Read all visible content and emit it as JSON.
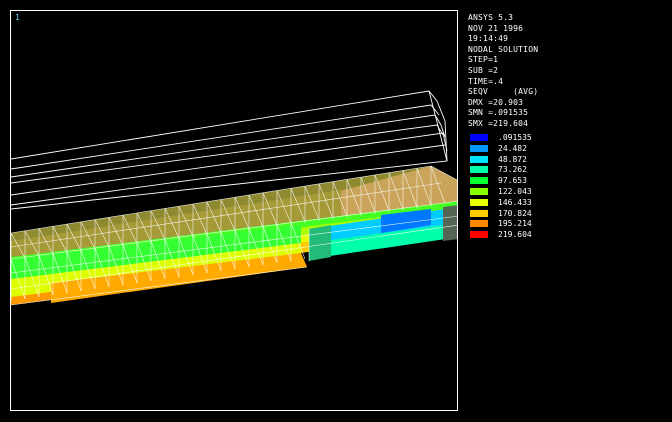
{
  "window": {
    "number": "1"
  },
  "header": {
    "lines": [
      "ANSYS 5.3",
      "NOV 21 1996",
      "19:14:49",
      "NODAL SOLUTION",
      "STEP=1",
      "SUB =2",
      "TIME=.4",
      "SEQV     (AVG)",
      "DMX =20.903",
      "SMN =.091535",
      "SMX =219.604"
    ]
  },
  "legend": [
    {
      "label": ".091535",
      "color": "#0000ff"
    },
    {
      "label": "24.482",
      "color": "#0099ff"
    },
    {
      "label": "48.872",
      "color": "#00e5ff"
    },
    {
      "label": "73.262",
      "color": "#00ffaa"
    },
    {
      "label": "97.653",
      "color": "#00ff33"
    },
    {
      "label": "122.043",
      "color": "#88ff00"
    },
    {
      "label": "146.433",
      "color": "#e6ff00"
    },
    {
      "label": "170.824",
      "color": "#ffcc00"
    },
    {
      "label": "195.214",
      "color": "#ff8800"
    },
    {
      "label": "219.604",
      "color": "#ff0000"
    }
  ]
}
